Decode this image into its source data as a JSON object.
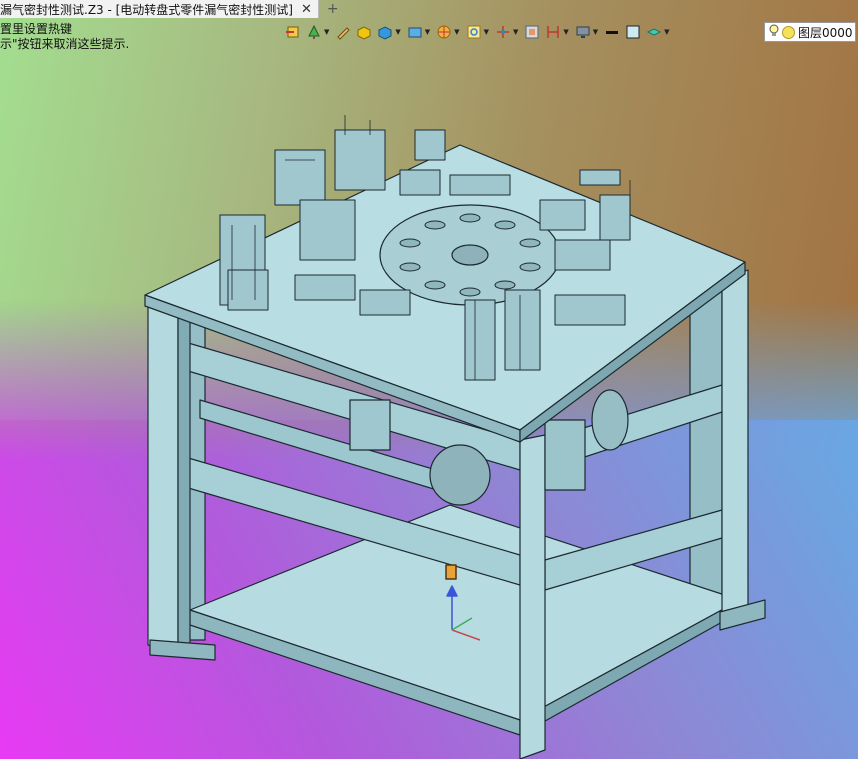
{
  "tabs": [
    {
      "label": "漏气密封性测试.Z3 - [电动转盘式零件漏气密封性测试]",
      "close": "✕"
    }
  ],
  "tab_add": "+",
  "hint_lines": [
    "置里设置热键",
    "示\"按钮来取消这些提示."
  ],
  "layer": {
    "label": "图层0000"
  },
  "toolbar_icons": [
    "exit-icon",
    "tree-icon",
    "pen-icon",
    "box-icon",
    "solid-icon",
    "render-icon",
    "target-icon",
    "zoom-icon",
    "axis-icon",
    "frame-icon",
    "dimension-icon",
    "monitor-icon",
    "line-icon",
    "color-icon",
    "layer-stack-icon"
  ],
  "colors": {
    "model_fill": "#a7cfd6",
    "model_edge": "#1c2a30"
  }
}
